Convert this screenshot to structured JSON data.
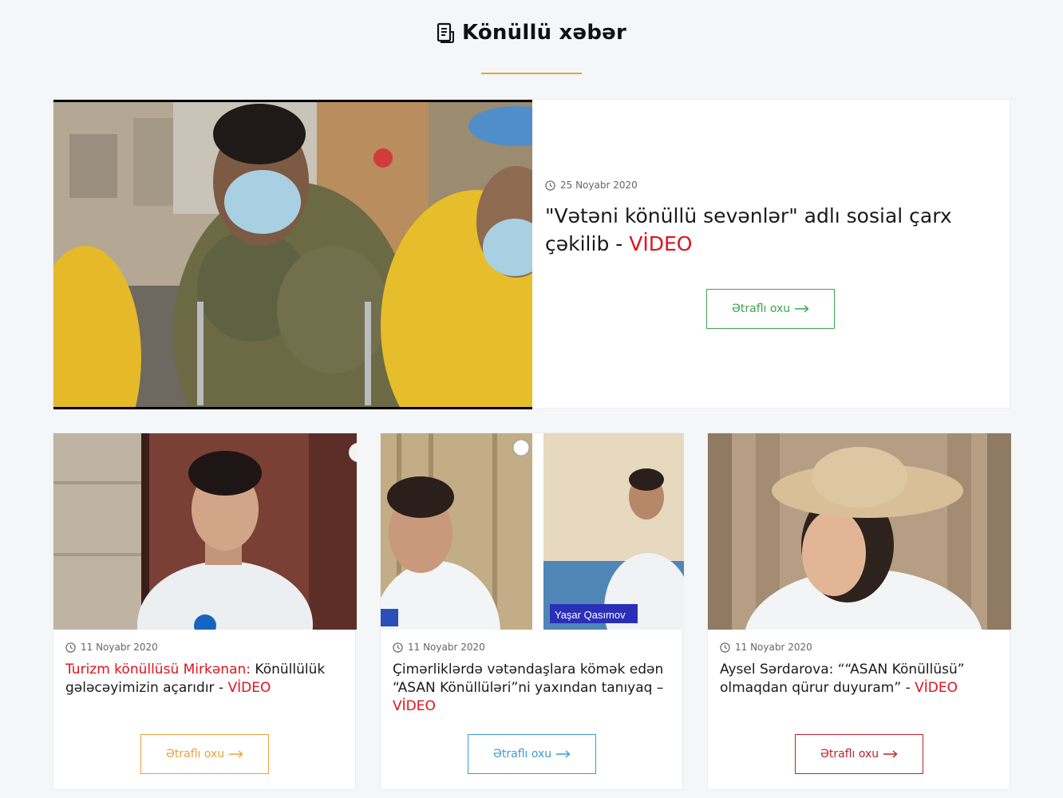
{
  "section": {
    "title": "Könüllü xəbər"
  },
  "featured": {
    "date": "25 Noyabr 2020",
    "title": "\"Vətəni könüllü sevənlər\" adlı sosial çarx çəkilib - ",
    "video_tag": "VİDEO",
    "button": "Ətraflı oxu"
  },
  "cards": [
    {
      "date": "11 Noyabr 2020",
      "title_highlight": "Turizm könüllüsü Mirkənan:",
      "title": " Könüllülük gələcəyimizin açarıdır - ",
      "video_tag": "VİDEO",
      "button": "Ətraflı oxu",
      "accent": "#e8a23a"
    },
    {
      "date": "11 Noyabr 2020",
      "title": "Çimərliklərdə vətəndaşlara kömək edən “ASAN Könüllüləri”ni yaxından tanıyaq – ",
      "video_tag": "VİDEO",
      "button": "Ətraflı oxu",
      "image_caption": "Yaşar Qasımov",
      "accent": "#3d9bd1"
    },
    {
      "date": "11 Noyabr 2020",
      "title": "Aysel Sərdarova: ““ASAN Könüllüsü” olmaqdan qürur duyuram” - ",
      "video_tag": "VİDEO",
      "button": "Ətraflı oxu",
      "accent": "#c41e2b"
    }
  ],
  "icons": {
    "title": "document-icon",
    "date": "clock-icon",
    "button": "arrow-right-icon"
  },
  "colors": {
    "accent_orange": "#e8a23a",
    "video_red": "#e1121e",
    "btn_green": "#3fa34d"
  }
}
